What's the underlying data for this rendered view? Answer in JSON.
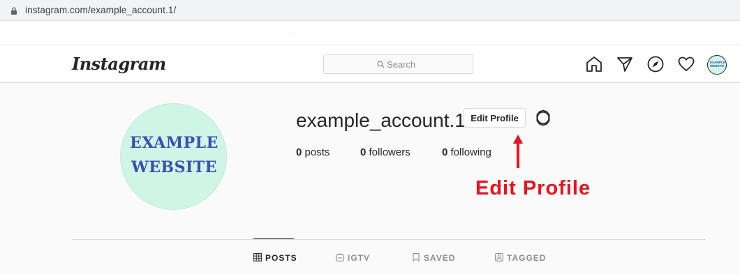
{
  "browser": {
    "url": "instagram.com/example_account.1/"
  },
  "header": {
    "logo": "Instagram",
    "search_placeholder": "Search",
    "nav_icons": [
      "home-icon",
      "direct-icon",
      "explore-icon",
      "activity-icon",
      "avatar"
    ]
  },
  "profile": {
    "avatar_line1": "EXAMPLE",
    "avatar_line2": "WEBSITE",
    "username": "example_account.1",
    "edit_label": "Edit Profile",
    "stats": {
      "posts_count": "0",
      "posts_label": "posts",
      "followers_count": "0",
      "followers_label": "followers",
      "following_count": "0",
      "following_label": "following"
    }
  },
  "annotation": {
    "text": "Edit Profile",
    "color": "#e8131d"
  },
  "tabs": [
    {
      "label": "POSTS",
      "active": true
    },
    {
      "label": "IGTV",
      "active": false
    },
    {
      "label": "SAVED",
      "active": false
    },
    {
      "label": "TAGGED",
      "active": false
    }
  ],
  "colors": {
    "accent_text": "#262626",
    "muted": "#8e8e8e",
    "avatar_bg": "#cff5e7",
    "avatar_text": "#3a4fb0"
  }
}
